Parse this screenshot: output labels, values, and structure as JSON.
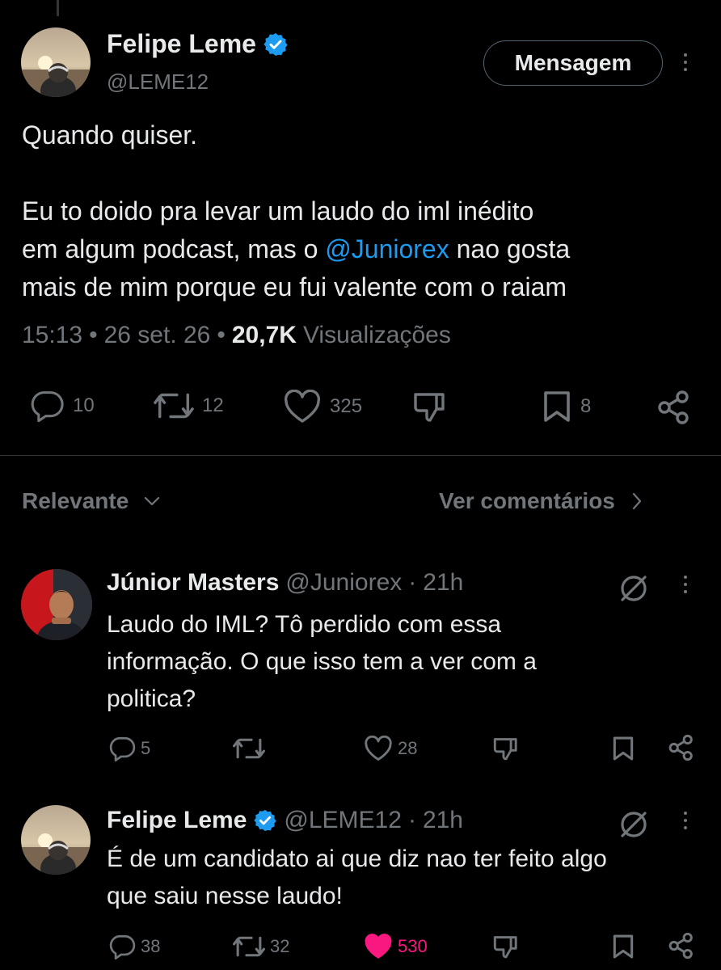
{
  "main_tweet": {
    "author_name": "Felipe Leme",
    "handle": "@LEME12",
    "message_button": "Mensagem",
    "text_line1": "Quando quiser.",
    "text_line2": "Eu to doido pra levar um laudo do iml inédito",
    "text_line3": "em algum podcast, mas o ",
    "text_mention": "@Juniorex",
    "text_line3_end": " nao gosta",
    "text_line4": "mais de mim porque eu fui valente com o raiam",
    "time": "15:13",
    "sep1": "•",
    "date": "26 set. 26",
    "sep2": "•",
    "views_count": "20,7K",
    "views_label": "Visualizações",
    "replies": "10",
    "reposts": "12",
    "likes": "325",
    "bookmarks": "8"
  },
  "sort": {
    "label": "Relevante",
    "see_comments": "Ver comentários"
  },
  "replies": [
    {
      "author_name": "Júnior Masters",
      "handle": "@Juniorex",
      "sep": "·",
      "time": "21h",
      "line1": "Laudo do IML? Tô perdido com essa",
      "line2": "informação. O que isso tem a ver com a",
      "line3": "politica?",
      "replies": "5",
      "reposts": "",
      "likes": "28"
    },
    {
      "author_name": "Felipe Leme",
      "handle": "@LEME12",
      "sep": "·",
      "time": "21h",
      "line1": "É de um candidato ai que diz nao ter feito algo",
      "line2": "que saiu nesse laudo!",
      "replies": "38",
      "reposts": "32",
      "likes": "530"
    }
  ],
  "colors": {
    "background": "#000000",
    "text": "#e7e9ea",
    "muted": "#71767b",
    "accent": "#1d9bf0",
    "like_active": "#f91880"
  },
  "icons": [
    "verified-badge-icon",
    "reply-icon",
    "repost-icon",
    "like-icon",
    "dislike-icon",
    "bookmark-icon",
    "share-icon",
    "more-icon",
    "chevron-down-icon",
    "chevron-right-icon",
    "grok-icon"
  ]
}
